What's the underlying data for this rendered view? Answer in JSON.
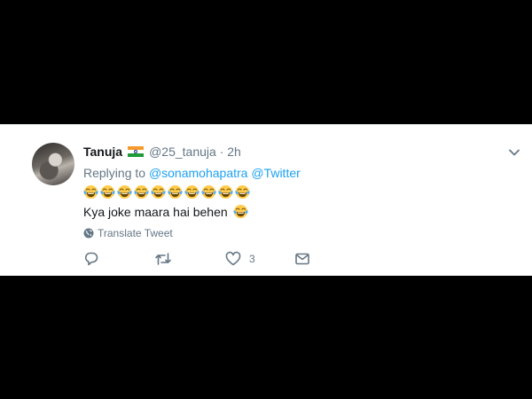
{
  "tweet": {
    "author_name": "Tanuja",
    "author_handle": "@25_tanuja",
    "separator": "·",
    "time": "2h",
    "replying_prefix": "Replying to",
    "reply_mentions": [
      "@sonamohapatra",
      "@Twitter"
    ],
    "emoji_count": 10,
    "body_text": "Kya joke maara hai behen",
    "translate_label": "Translate Tweet",
    "like_count": "3"
  },
  "icons": {
    "flag": "india-flag-icon",
    "caret": "chevron-down-icon",
    "emoji": "face-with-tears-of-joy-icon",
    "globe": "globe-icon",
    "reply": "reply-icon",
    "retweet": "retweet-icon",
    "like": "heart-icon",
    "dm": "direct-message-icon"
  },
  "colors": {
    "link": "#1da1f2",
    "muted": "#657786",
    "text": "#14171a",
    "background": "#000000",
    "card": "#ffffff"
  }
}
